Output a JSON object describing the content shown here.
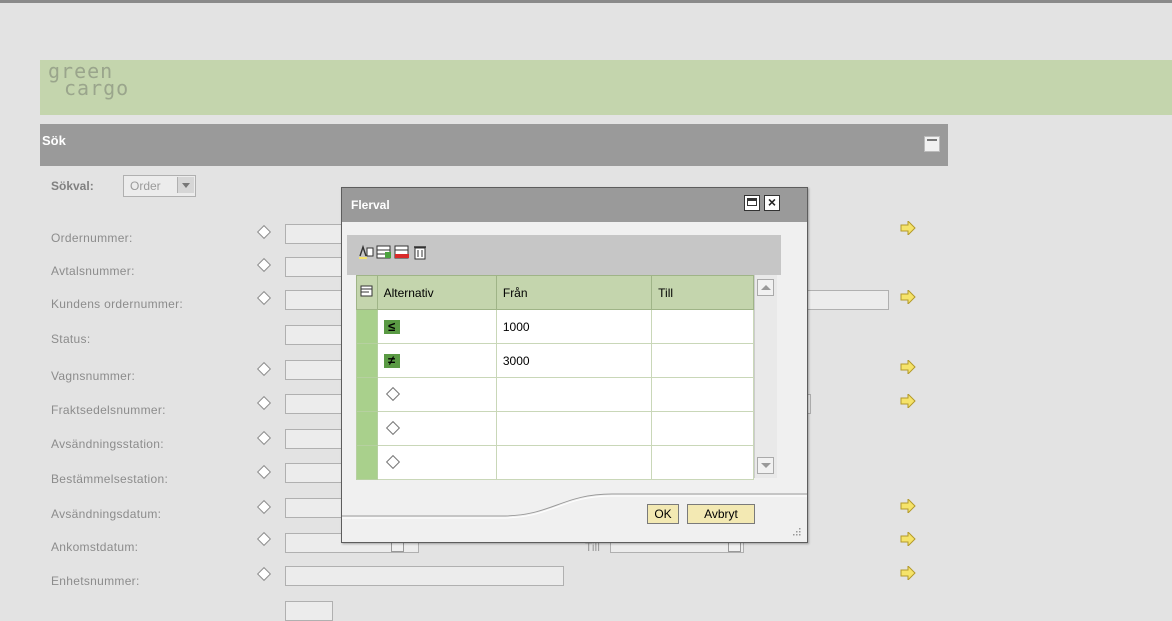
{
  "brand": {
    "logo_line1": "green",
    "logo_line2": "cargo"
  },
  "panel": {
    "title": "Sök"
  },
  "sokval": {
    "label": "Sökval:",
    "value": "Order"
  },
  "fields": [
    {
      "label": "Ordernummer:"
    },
    {
      "label": "Avtalsnummer:"
    },
    {
      "label": "Kundens ordernummer:"
    },
    {
      "label": "Status:"
    },
    {
      "label": "Vagnsnummer:"
    },
    {
      "label": "Fraktsedelsnummer:"
    },
    {
      "label": "Avsändningsstation:"
    },
    {
      "label": "Bestämmelsestation:"
    },
    {
      "label": "Avsändningsdatum:"
    },
    {
      "label": "Ankomstdatum:"
    },
    {
      "label": "Enhetsnummer:"
    }
  ],
  "till_label": "Till",
  "dialog": {
    "title": "Flerval",
    "columns": {
      "alternativ": "Alternativ",
      "fran": "Från",
      "till": "Till"
    },
    "rows": [
      {
        "operator": "≤",
        "fran": "1000",
        "till": ""
      },
      {
        "operator": "≠",
        "fran": "3000",
        "till": ""
      },
      {
        "operator": "",
        "fran": "",
        "till": ""
      },
      {
        "operator": "",
        "fran": "",
        "till": ""
      },
      {
        "operator": "",
        "fran": "",
        "till": ""
      }
    ],
    "ok_label": "OK",
    "cancel_label": "Avbryt"
  },
  "colors": {
    "brand_band": "#c4d5ad",
    "header_gray": "#9a9a9a",
    "selector_green": "#a9d08c",
    "button_yellow": "#f3e9b3",
    "nav_arrow": "#f5e36a"
  }
}
